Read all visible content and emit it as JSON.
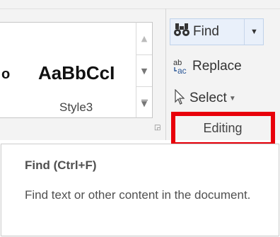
{
  "styles_gallery": {
    "prev_sample": "o",
    "sample": "AaBbCcI",
    "style_name": "Style3"
  },
  "editing": {
    "find_label": "Find",
    "replace_label": "Replace",
    "replace_icon_text": "ab\nac",
    "select_label": "Select",
    "group_label": "Editing",
    "highlight_color": "#e8000b"
  },
  "tooltip": {
    "title": "Find (Ctrl+F)",
    "description": "Find text or other content in the document."
  },
  "icons": {
    "find": "binoculars-icon",
    "replace": "replace-icon",
    "select": "cursor-icon"
  }
}
